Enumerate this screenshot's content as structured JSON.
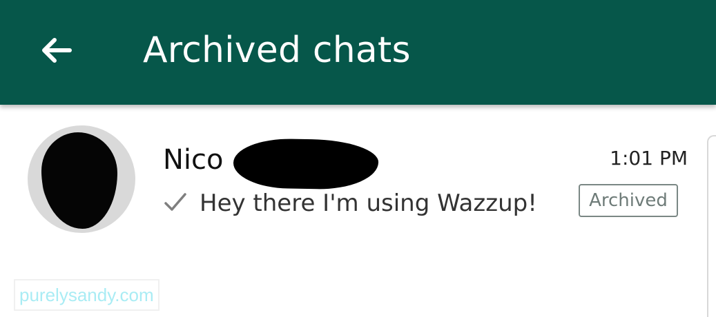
{
  "appbar": {
    "title": "Archived chats",
    "back_icon": "arrow-left-icon",
    "background_color": "#06574a"
  },
  "chat": {
    "name": "Nico",
    "time": "1:01 PM",
    "status_icon": "check-icon",
    "preview": "Hey there I'm using Wazzup!",
    "badge": "Archived"
  },
  "watermark": {
    "text": "purelysandy.com"
  }
}
